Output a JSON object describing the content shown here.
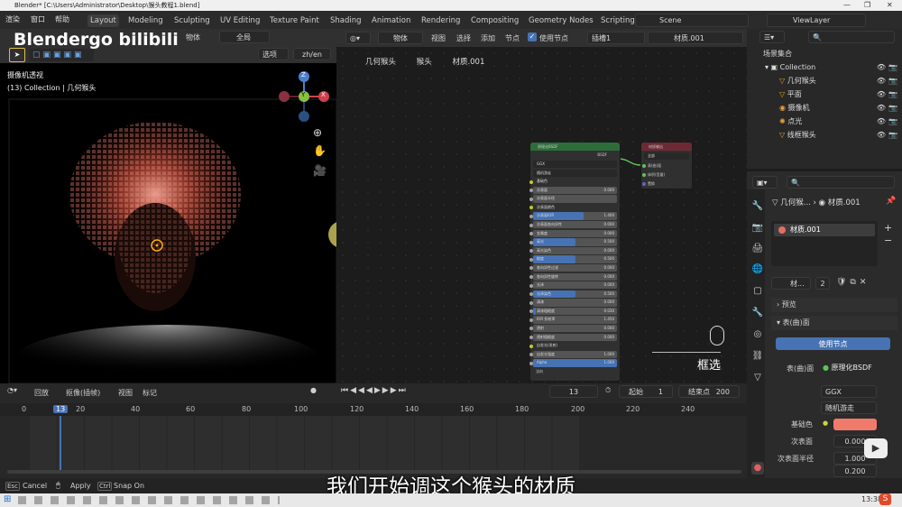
{
  "window": {
    "title": "Blender* [C:\\Users\\Administrator\\Desktop\\猴头教程1.blend]"
  },
  "menu": [
    "渲染",
    "窗口",
    "帮助"
  ],
  "workspaces": [
    "Layout",
    "Modeling",
    "Sculpting",
    "UV Editing",
    "Texture Paint",
    "Shading",
    "Animation",
    "Rendering",
    "Compositing",
    "Geometry Nodes",
    "Scripting"
  ],
  "scene": "Scene",
  "viewlayer": "ViewLayer",
  "watermark": "Blendergo bilibili",
  "viewport": {
    "mode": "物体",
    "transform": "全局",
    "options": "选项",
    "lang": "zh/en",
    "view_name": "摄像机透视",
    "collection": "(13) Collection | 几何猴头",
    "gizmo": {
      "x": "X",
      "y": "Y",
      "z": "Z"
    }
  },
  "node_header": {
    "mode": "物体",
    "view": "视图",
    "select": "选择",
    "add": "添加",
    "node": "节点",
    "use_nodes": "使用节点",
    "slot": "插槽1",
    "material": "材质.001"
  },
  "breadcrumb": [
    "几何猴头",
    "猴头",
    "材质.001"
  ],
  "bsdf": {
    "title": "原理化BSDF",
    "output": "BSDF",
    "dist": "GGX",
    "sss": "随机游走",
    "rows": [
      {
        "label": "基础色",
        "value": "",
        "color": "#f07b6d"
      },
      {
        "label": "次表面",
        "value": "0.000",
        "fill": 0
      },
      {
        "label": "次表面半径",
        "value": "",
        "fill": 0
      },
      {
        "label": "次表面颜色",
        "value": "",
        "color": "#ececec"
      },
      {
        "label": "次表面IOR",
        "value": "1.400",
        "fill": 0.6
      },
      {
        "label": "次表面各向异性",
        "value": "0.000",
        "fill": 0
      },
      {
        "label": "金属度",
        "value": "0.000",
        "fill": 0
      },
      {
        "label": "高光",
        "value": "0.500",
        "fill": 0.5
      },
      {
        "label": "高光染色",
        "value": "0.000",
        "fill": 0
      },
      {
        "label": "糙度",
        "value": "0.500",
        "fill": 0.5
      },
      {
        "label": "各向异性过滤",
        "value": "0.000",
        "fill": 0
      },
      {
        "label": "各向异性旋转",
        "value": "0.000",
        "fill": 0
      },
      {
        "label": "光泽",
        "value": "0.000",
        "fill": 0
      },
      {
        "label": "光泽染色",
        "value": "0.500",
        "fill": 0.5
      },
      {
        "label": "清漆",
        "value": "0.000",
        "fill": 0
      },
      {
        "label": "清漆粗糙度",
        "value": "0.030",
        "fill": 0.03
      },
      {
        "label": "IOR 折射率",
        "value": "1.450",
        "fill": 0
      },
      {
        "label": "透射",
        "value": "0.000",
        "fill": 0
      },
      {
        "label": "透射粗糙度",
        "value": "0.000",
        "fill": 0
      },
      {
        "label": "自发光(发射)",
        "value": "",
        "color": "#000000"
      },
      {
        "label": "自发光强度",
        "value": "1.000",
        "fill": 0
      },
      {
        "label": "Alpha",
        "value": "1.000",
        "fill": 1
      }
    ],
    "tail": "法向"
  },
  "matout": {
    "title": "材质输出",
    "target": "全部",
    "sockets": [
      "表(曲)面",
      "体积(音量)",
      "置换"
    ]
  },
  "mouse_hint": "框选",
  "outliner": {
    "root": "场景集合",
    "collection": "Collection",
    "items": [
      "几何猴头",
      "平面",
      "摄像机",
      "点光",
      "线框猴头"
    ]
  },
  "props": {
    "breadcrumb_obj": "几何猴...",
    "breadcrumb_mat": "材质.001",
    "slot": "材质.001",
    "mat_name": "材...",
    "users": "2",
    "preview": "预览",
    "surface_panel": "表(曲)面",
    "use_nodes": "使用节点",
    "surface_label": "表(曲)面",
    "surface_value": "原理化BSDF",
    "dist": "GGX",
    "sss": "随机游走",
    "base_color_label": "基础色",
    "base_color": "#f07b6d",
    "subsurface_label": "次表面",
    "subsurface": "0.000",
    "sss_radius_label": "次表面半径",
    "sss_r1": "1.000",
    "sss_r2": "0.200"
  },
  "timeline": {
    "playback": "回放",
    "keying": "抠像(插帧)",
    "view": "视图",
    "marker": "标记",
    "current": "13",
    "start_label": "起始",
    "start": "1",
    "end_label": "结束点",
    "end": "200",
    "ticks": [
      "0",
      "13",
      "20",
      "40",
      "60",
      "80",
      "100",
      "120",
      "140",
      "160",
      "180",
      "200",
      "220",
      "240"
    ]
  },
  "status": {
    "cancel": "Cancel",
    "apply": "Apply",
    "snap": "Snap On"
  },
  "subtitle": "我们开始调这个猴头的材质",
  "clock": "13:38"
}
